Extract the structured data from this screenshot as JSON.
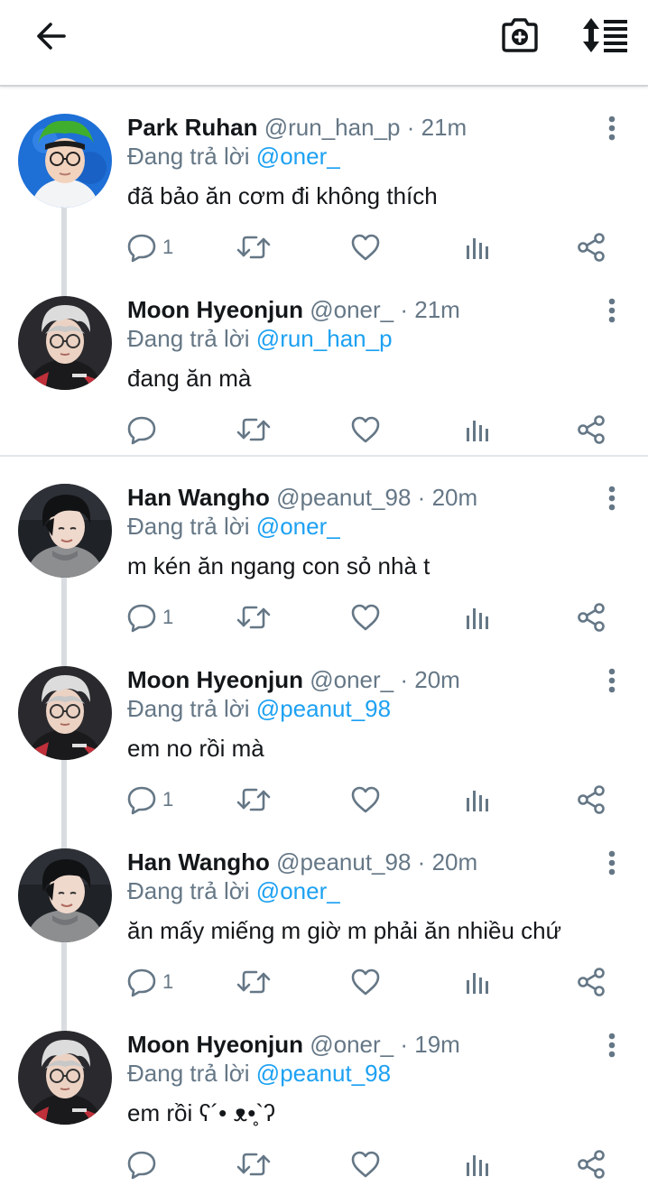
{
  "topbar": {
    "back_icon": "arrow-left-icon",
    "camera_icon": "camera-plus-icon",
    "sort_icon": "sort-list-icon"
  },
  "colors": {
    "mention": "#1da1f2",
    "secondary": "#657786",
    "thread_line": "#d9dde1"
  },
  "tweets": [
    {
      "name": "Park Ruhan",
      "handle": "@run_han_p",
      "sep": "·",
      "time": "21m",
      "reply_prefix": "Đang trả lời",
      "reply_to": "@oner_",
      "text": "đã bảo ăn cơm đi không thích",
      "reply_count": "1",
      "avatar": "park-ruhan"
    },
    {
      "name": "Moon Hyeonjun",
      "handle": "@oner_",
      "sep": "·",
      "time": "21m",
      "reply_prefix": "Đang trả lời",
      "reply_to": "@run_han_p",
      "text": "đang ăn mà",
      "reply_count": "",
      "avatar": "moon-hyeonjun"
    },
    {
      "name": "Han Wangho",
      "handle": "@peanut_98",
      "sep": "·",
      "time": "20m",
      "reply_prefix": "Đang trả lời",
      "reply_to": "@oner_",
      "text": "m kén ăn ngang con sỏ nhà t",
      "reply_count": "1",
      "avatar": "han-wangho"
    },
    {
      "name": "Moon Hyeonjun",
      "handle": "@oner_",
      "sep": "·",
      "time": "20m",
      "reply_prefix": "Đang trả lời",
      "reply_to": "@peanut_98",
      "text": "em no rồi mà",
      "reply_count": "1",
      "avatar": "moon-hyeonjun"
    },
    {
      "name": "Han Wangho",
      "handle": "@peanut_98",
      "sep": "·",
      "time": "20m",
      "reply_prefix": "Đang trả lời",
      "reply_to": "@oner_",
      "text": "ăn mấy miếng m giờ m phải ăn nhiều chứ",
      "reply_count": "1",
      "avatar": "han-wangho"
    },
    {
      "name": "Moon Hyeonjun",
      "handle": "@oner_",
      "sep": "·",
      "time": "19m",
      "reply_prefix": "Đang trả lời",
      "reply_to": "@peanut_98",
      "text": "em rồi ʕ´• ᴥ•̥`ʔ",
      "reply_count": "",
      "avatar": "moon-hyeonjun"
    }
  ]
}
